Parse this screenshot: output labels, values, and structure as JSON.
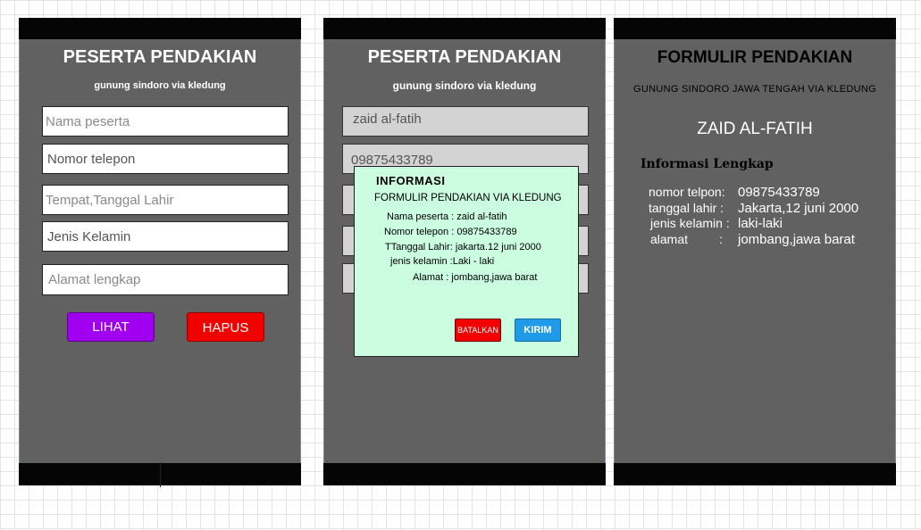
{
  "screen1": {
    "title": "PESERTA PENDAKIAN",
    "subtitle": "gunung sindoro via kledung",
    "fields": [
      {
        "placeholder": "Nama peserta"
      },
      {
        "placeholder": "Nomor telepon"
      },
      {
        "placeholder": "Tempat,Tanggal Lahir"
      },
      {
        "placeholder": "Jenis Kelamin"
      },
      {
        "placeholder": "Alamat lengkap"
      }
    ],
    "lihat_label": "LIHAT",
    "hapus_label": "HAPUS",
    "colors": {
      "lihat": "#a100f0",
      "hapus": "#f20000"
    }
  },
  "screen2": {
    "title": "PESERTA PENDAKIAN",
    "subtitle": "gunung sindoro via kledung",
    "fields": [
      {
        "value": "zaid al-fatih"
      },
      {
        "value": "09875433789"
      }
    ],
    "dialog": {
      "title": "INFORMASI",
      "subtitle": "FORMULIR PENDAKIAN VIA KLEDUNG",
      "lines": [
        "Nama peserta :  zaid al-fatih",
        "Nomor telepon : 09875433789",
        "TTanggal Lahir: jakarta.12 juni 2000",
        "jenis kelamin :Laki - laki",
        "Alamat : jombang,jawa barat"
      ],
      "batalkan_label": "BATALKAN",
      "kirim_label": "KIRIM",
      "colors": {
        "background": "#cbfde0",
        "batalkan": "#f20000",
        "kirim": "#1e9ae6"
      }
    }
  },
  "screen3": {
    "title": "FORMULIR PENDAKIAN",
    "subtitle": "GUNUNG SINDORO JAWA TENGAH VIA KLEDUNG",
    "name": "ZAID AL-FATIH",
    "section_title": "Informasi Lengkap",
    "rows": [
      {
        "label": "nomor telpon:",
        "value": "09875433789"
      },
      {
        "label": "tanggal lahir :",
        "value": "Jakarta,12 juni 2000"
      },
      {
        "label": "jenis kelamin :",
        "value": "laki-laki"
      },
      {
        "label": "alamat         :",
        "value": "jombang,jawa barat"
      }
    ]
  },
  "colors": {
    "phone_bg": "#616161",
    "bars": "#050505"
  }
}
